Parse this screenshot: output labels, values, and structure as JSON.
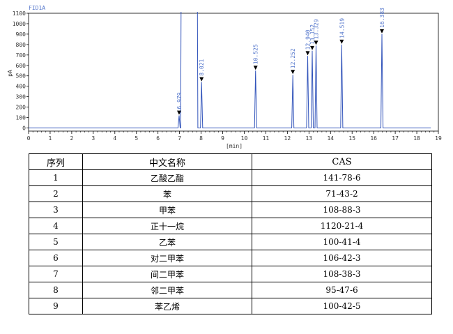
{
  "chart_data": {
    "type": "line",
    "channel_label": "FID1A",
    "ylabel": "pA",
    "xlabel": "[min]",
    "xlim": [
      0,
      19
    ],
    "ylim": [
      -30,
      1100
    ],
    "x_ticks": [
      "0",
      "1",
      "2",
      "3",
      "4",
      "5",
      "6",
      "7",
      "8",
      "9",
      "10",
      "11",
      "12",
      "13",
      "14",
      "15",
      "16",
      "17",
      "18",
      "19"
    ],
    "y_ticks": [
      "0",
      "100",
      "200",
      "300",
      "400",
      "500",
      "600",
      "700",
      "800",
      "900",
      "1000",
      "1100"
    ],
    "trace_end": 18.65,
    "peaks": [
      {
        "rt": 6.979,
        "height": 120,
        "label": "6.979"
      },
      {
        "rt": 8.021,
        "height": 440,
        "label": "8.021"
      },
      {
        "rt": 10.525,
        "height": 550,
        "label": "10.525"
      },
      {
        "rt": 12.252,
        "height": 510,
        "label": "12.252"
      },
      {
        "rt": 12.94,
        "height": 690,
        "label": "12.940"
      },
      {
        "rt": 13.152,
        "height": 740,
        "label": "13.152"
      },
      {
        "rt": 13.329,
        "height": 790,
        "label": "13.329"
      },
      {
        "rt": 14.519,
        "height": 800,
        "label": "14.519"
      },
      {
        "rt": 16.383,
        "height": 900,
        "label": "16.383"
      }
    ],
    "solvent_peak": {
      "start": 7.05,
      "end": 7.85
    }
  },
  "table": {
    "headers": [
      "序列",
      "中文名称",
      "CAS"
    ],
    "rows": [
      [
        "1",
        "乙酸乙酯",
        "141-78-6"
      ],
      [
        "2",
        "苯",
        "71-43-2"
      ],
      [
        "3",
        "甲苯",
        "108-88-3"
      ],
      [
        "4",
        "正十一烷",
        "1120-21-4"
      ],
      [
        "5",
        "乙苯",
        "100-41-4"
      ],
      [
        "6",
        "对二甲苯",
        "106-42-3"
      ],
      [
        "7",
        "间二甲苯",
        "108-38-3"
      ],
      [
        "8",
        "邻二甲苯",
        "95-47-6"
      ],
      [
        "9",
        "苯乙烯",
        "100-42-5"
      ]
    ]
  },
  "colors": {
    "trace": "#3355bb",
    "axis": "#000000"
  }
}
